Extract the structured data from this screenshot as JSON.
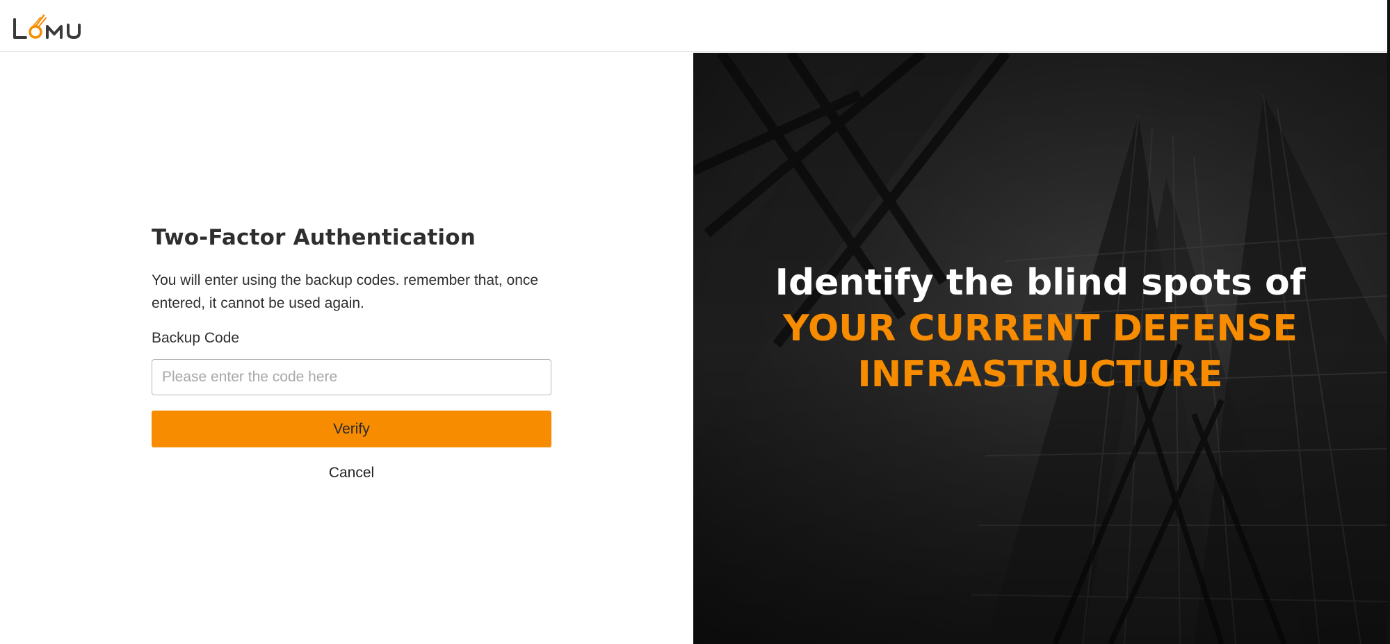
{
  "brand": {
    "name": "LUMU",
    "accent_color": "#f78c00"
  },
  "form": {
    "title": "Two-Factor Authentication",
    "description": "You will enter using the backup codes. remember that, once entered, it cannot be used again.",
    "backup_code_label": "Backup Code",
    "backup_code_value": "",
    "backup_code_placeholder": "Please enter the code here",
    "verify_label": "Verify",
    "cancel_label": "Cancel"
  },
  "hero": {
    "line1": "Identify the blind spots of",
    "line2": "YOUR CURRENT DEFENSE",
    "line3": "INFRASTRUCTURE",
    "line1_color": "#ffffff",
    "highlight_color": "#f78c00",
    "background_image": "dark-skyscraper-photo"
  }
}
